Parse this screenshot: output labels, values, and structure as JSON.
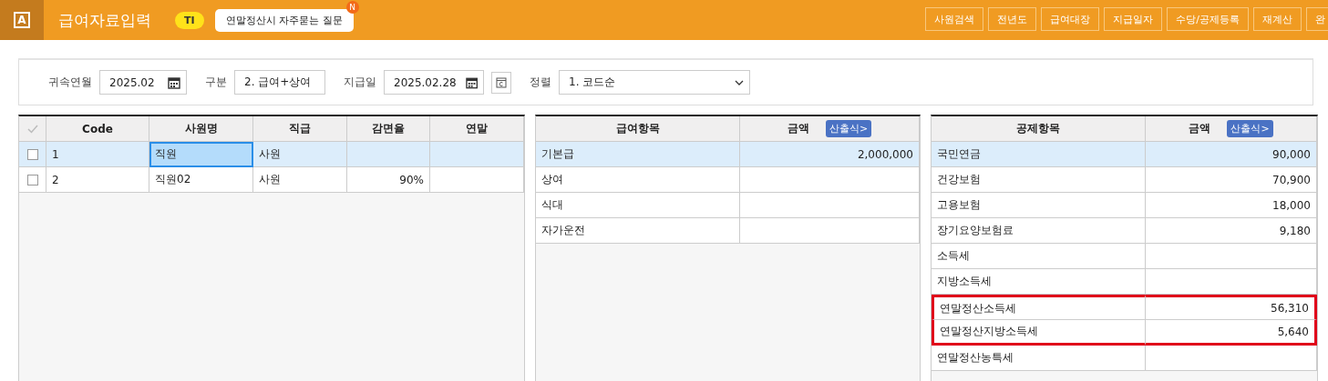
{
  "header": {
    "logo": "A",
    "title": "급여자료입력",
    "badge": "TI",
    "tip": "연말정산시 자주묻는 질문",
    "tip_badge": "N",
    "buttons": [
      "사원검색",
      "전년도",
      "급여대장",
      "지급일자",
      "수당/공제등록",
      "재계산",
      "완"
    ]
  },
  "filters": [
    {
      "kind": "date",
      "label": "귀속연월",
      "value": "2025.02"
    },
    {
      "kind": "select",
      "label": "구분",
      "value": "2. 급여+상여"
    },
    {
      "kind": "date",
      "label": "지급일",
      "value": "2025.02.28",
      "extra": true
    },
    {
      "kind": "select",
      "label": "정렬",
      "value": "1. 코드순",
      "wide": true
    }
  ],
  "employees": {
    "columns": [
      "Code",
      "사원명",
      "직급",
      "감면율",
      "연말"
    ],
    "rows": [
      {
        "checked": false,
        "selected": true,
        "cells": [
          "1",
          "직원",
          "사원",
          "",
          ""
        ]
      },
      {
        "checked": false,
        "selected": false,
        "cells": [
          "2",
          "직원02",
          "사원",
          "90%",
          ""
        ]
      }
    ]
  },
  "pay": {
    "columns": [
      "급여항목",
      "금액"
    ],
    "formula": "산출식>",
    "rows": [
      {
        "selected": true,
        "name": "기본급",
        "amount": "2,000,000"
      },
      {
        "selected": false,
        "name": "상여",
        "amount": ""
      },
      {
        "selected": false,
        "name": "식대",
        "amount": ""
      },
      {
        "selected": false,
        "name": "자가운전",
        "amount": ""
      }
    ]
  },
  "deductions": {
    "columns": [
      "공제항목",
      "금액"
    ],
    "formula": "산출식>",
    "rows": [
      {
        "selected": true,
        "highlighted": false,
        "name": "국민연금",
        "amount": "90,000"
      },
      {
        "selected": false,
        "highlighted": false,
        "name": "건강보험",
        "amount": "70,900"
      },
      {
        "selected": false,
        "highlighted": false,
        "name": "고용보험",
        "amount": "18,000"
      },
      {
        "selected": false,
        "highlighted": false,
        "name": "장기요양보험료",
        "amount": "9,180"
      },
      {
        "selected": false,
        "highlighted": false,
        "name": "소득세",
        "amount": ""
      },
      {
        "selected": false,
        "highlighted": false,
        "name": "지방소득세",
        "amount": ""
      },
      {
        "selected": false,
        "highlighted": true,
        "name": "연말정산소득세",
        "amount": "56,310"
      },
      {
        "selected": false,
        "highlighted": true,
        "name": "연말정산지방소득세",
        "amount": "5,640"
      },
      {
        "selected": false,
        "highlighted": false,
        "name": "연말정산농특세",
        "amount": ""
      }
    ]
  }
}
